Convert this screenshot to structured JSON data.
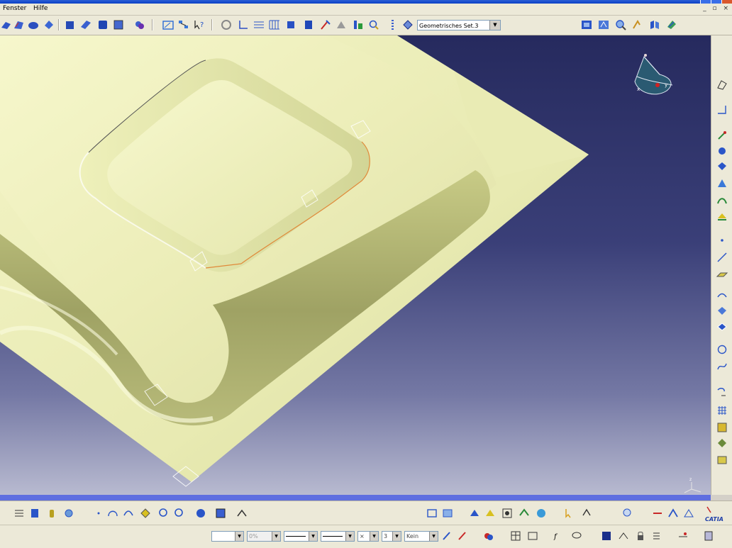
{
  "menu": {
    "items": [
      "Fenster",
      "Hilfe"
    ]
  },
  "window": {
    "controls": "_ ▫ ×"
  },
  "toolbar_top": {
    "geometric_set_value": "Geometrisches Set.3"
  },
  "toolbar_bottom": {
    "line_width_combo": "",
    "transparency_combo": "0%",
    "layer_combo": "3",
    "layer_name_combo": "Kein"
  },
  "brand": {
    "logo_text": "CATIA"
  },
  "compass": {
    "x_label": "x",
    "y_label": "y",
    "z_label": "z"
  },
  "colors": {
    "viewport_top": "#262a5e",
    "viewport_bottom": "#b8bad0",
    "part_surface": "#ececb0",
    "accent_bar": "#5e6ee0"
  }
}
